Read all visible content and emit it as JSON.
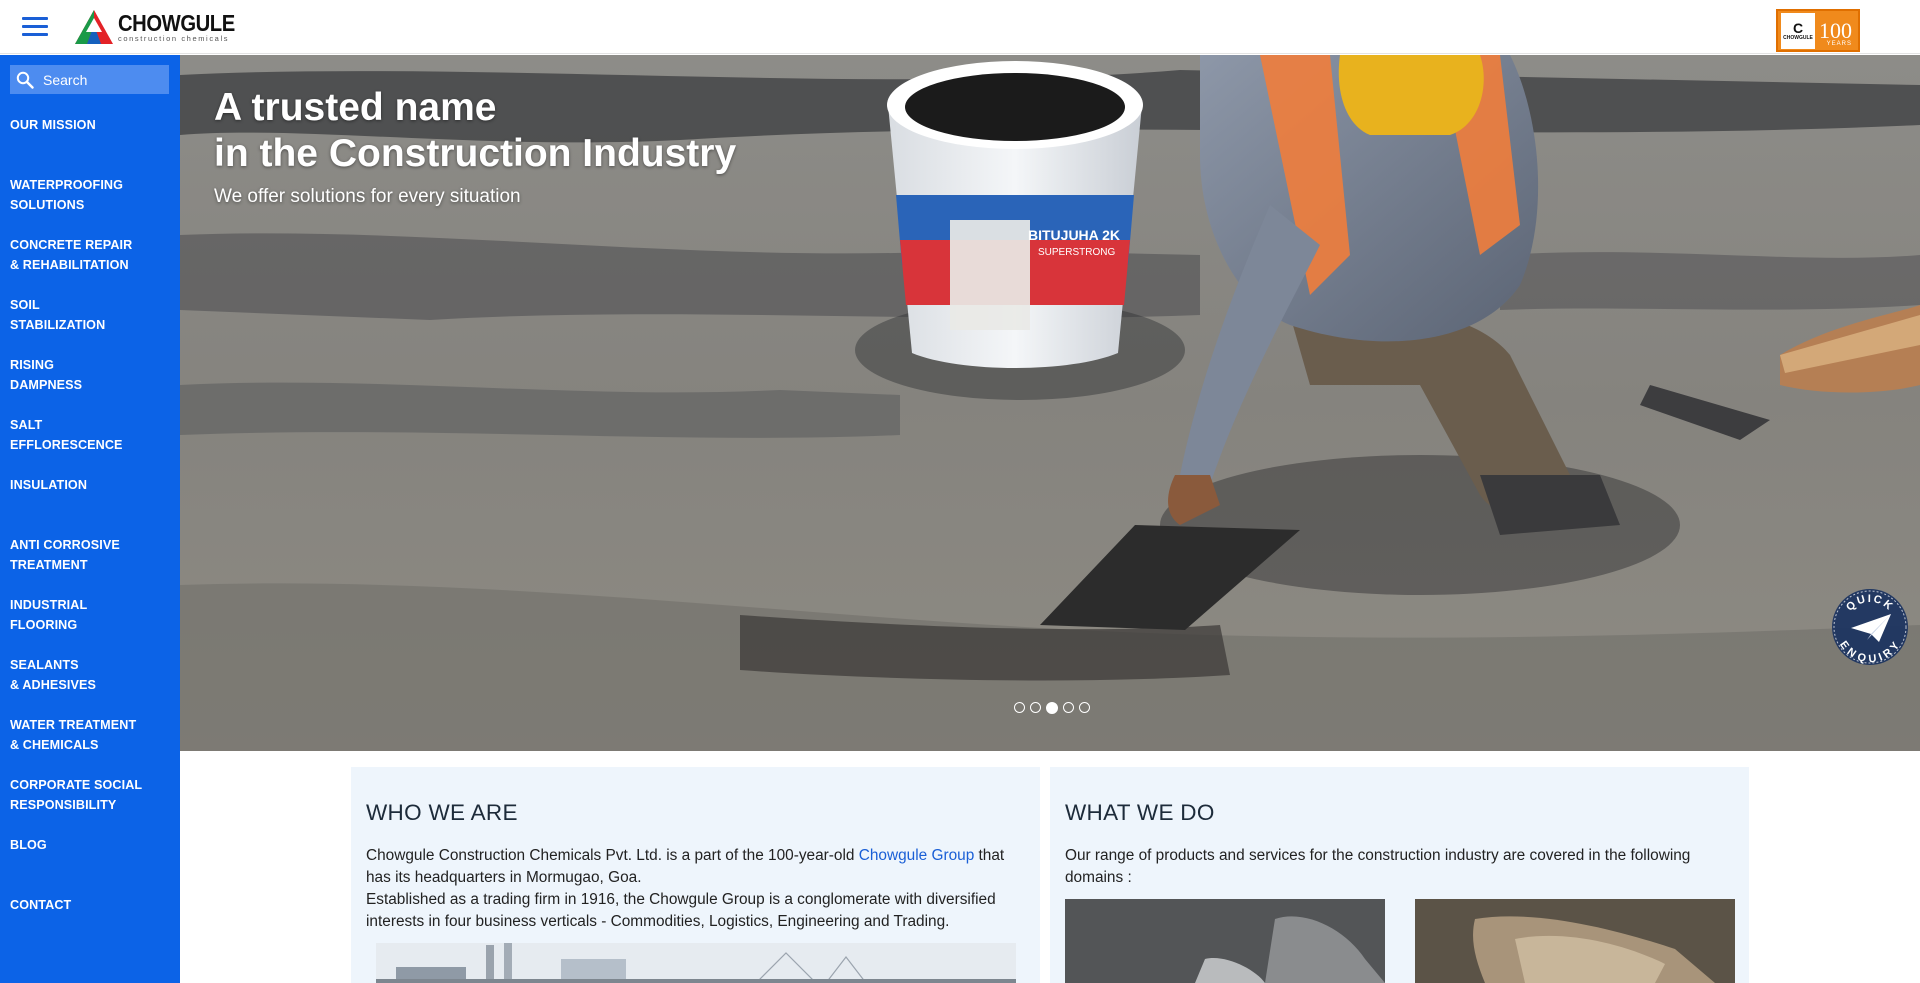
{
  "header": {
    "menu_icon": "hamburger-menu-icon",
    "logo_name": "CHOWGULE",
    "logo_subtitle": "construction chemicals",
    "badge_logo_text": "CHOWGULE",
    "badge_number": "100",
    "badge_years": "YEARS",
    "colors": {
      "brand_blue": "#0c63e7",
      "badge_orange": "#f08a1c"
    }
  },
  "sidebar": {
    "search_label": "Search",
    "search_icon": "search-icon",
    "items": [
      {
        "label": "OUR MISSION"
      },
      {
        "label": "WATERPROOFING\nSOLUTIONS"
      },
      {
        "label": "CONCRETE REPAIR\n& REHABILITATION"
      },
      {
        "label": "SOIL\nSTABILIZATION"
      },
      {
        "label": "RISING\nDAMPNESS"
      },
      {
        "label": "SALT\nEFFLORESCENCE"
      },
      {
        "label": "INSULATION"
      },
      {
        "label": "ANTI CORROSIVE\nTREATMENT"
      },
      {
        "label": "INDUSTRIAL\nFLOORING"
      },
      {
        "label": "SEALANTS\n& ADHESIVES"
      },
      {
        "label": "WATER TREATMENT\n& CHEMICALS"
      },
      {
        "label": "CORPORATE SOCIAL\nRESPONSIBILITY"
      },
      {
        "label": "BLOG"
      },
      {
        "label": "CONTACT"
      }
    ]
  },
  "hero": {
    "title": "A trusted name\nin the Construction Industry",
    "subtitle": "We offer solutions for every situation",
    "bucket_label_1": "BITUJUHA 2K",
    "bucket_label_2": "SUPERSTRONG",
    "slide_count": 5,
    "active_slide": 3,
    "quick_enquiry_top": "QUICK",
    "quick_enquiry_bottom": "ENQUIRY"
  },
  "who_we_are": {
    "heading": "WHO WE ARE",
    "para1_before": "Chowgule Construction Chemicals Pvt. Ltd. is a part of the 100-year-old ",
    "para1_link": "Chowgule Group",
    "para1_after": " that has its headquarters in Mormugao, Goa.",
    "para2": "Established as a trading firm in 1916, the Chowgule Group is a conglomerate with diversified interests in four business verticals - Commodities, Logistics, Engineering and Trading."
  },
  "what_we_do": {
    "heading": "WHAT WE DO",
    "text": "Our range of products and services for the construction industry are covered in the following domains :"
  }
}
